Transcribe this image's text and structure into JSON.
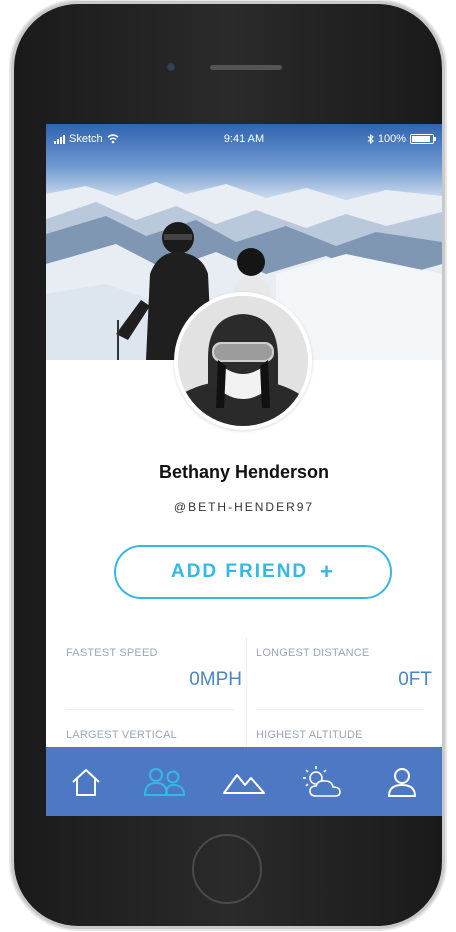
{
  "status_bar": {
    "carrier": "Sketch",
    "time": "9:41 AM",
    "battery": "100%"
  },
  "profile": {
    "name": "Bethany Henderson",
    "handle": "@BETH-HENDER97"
  },
  "add_friend": {
    "label": "ADD FRIEND",
    "icon": "plus-icon",
    "plus": "+"
  },
  "stats": [
    {
      "label": "FASTEST SPEED",
      "value": "0MPH"
    },
    {
      "label": "LONGEST DISTANCE",
      "value": "0FT"
    },
    {
      "label": "LARGEST VERTICAL",
      "value": ""
    },
    {
      "label": "HIGHEST ALTITUDE",
      "value": ""
    }
  ],
  "tab_bar": {
    "items": [
      {
        "icon": "home-icon",
        "active": false
      },
      {
        "icon": "friends-icon",
        "active": true
      },
      {
        "icon": "mountain-icon",
        "active": false
      },
      {
        "icon": "weather-icon",
        "active": false
      },
      {
        "icon": "profile-icon",
        "active": false
      }
    ]
  },
  "colors": {
    "accent": "#33b8e8",
    "tab_bar": "#4d79c4",
    "stat_value": "#4a86c7",
    "stat_label": "#9aa6b8"
  }
}
